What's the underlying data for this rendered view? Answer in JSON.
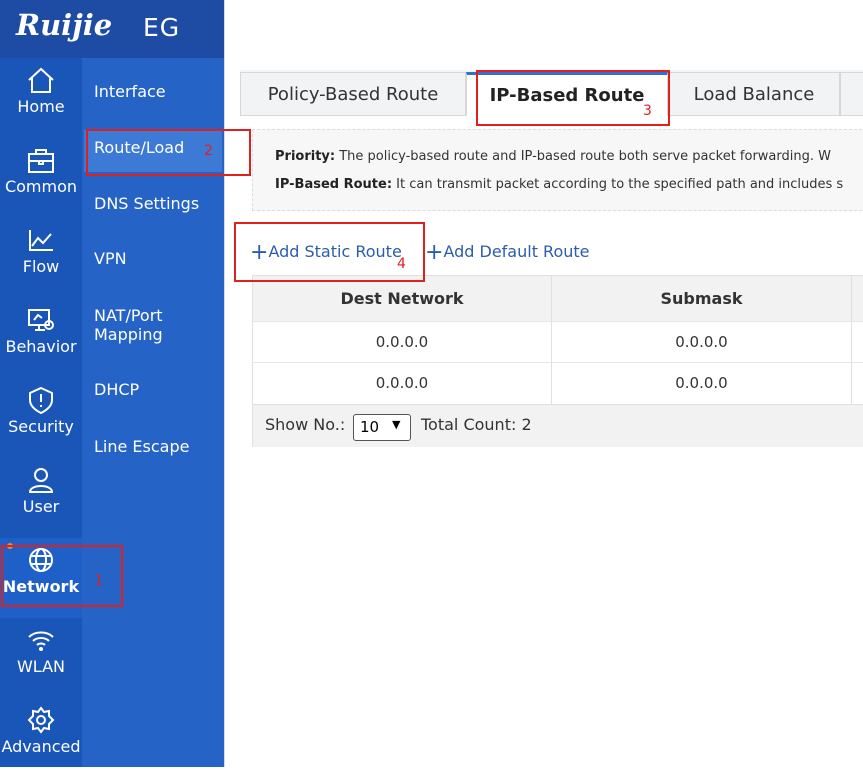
{
  "brand": {
    "logo": "Ruijie",
    "product": "EG"
  },
  "rail": [
    {
      "label": "Home",
      "icon": "home-icon"
    },
    {
      "label": "Common",
      "icon": "briefcase-icon"
    },
    {
      "label": "Flow",
      "icon": "chart-line-icon"
    },
    {
      "label": "Behavior",
      "icon": "monitor-icon"
    },
    {
      "label": "Security",
      "icon": "shield-icon"
    },
    {
      "label": "User",
      "icon": "user-icon"
    },
    {
      "label": "Network",
      "icon": "globe-icon"
    },
    {
      "label": "WLAN",
      "icon": "wifi-icon"
    },
    {
      "label": "Advanced",
      "icon": "gear-icon"
    }
  ],
  "subnav": [
    {
      "label": "Interface"
    },
    {
      "label": "Route/Load"
    },
    {
      "label": "DNS Settings"
    },
    {
      "label": "VPN"
    },
    {
      "label": "NAT/Port Mapping"
    },
    {
      "label": "DHCP"
    },
    {
      "label": "Line Escape"
    }
  ],
  "tabs": [
    {
      "label": "Policy-Based Route"
    },
    {
      "label": "IP-Based Route"
    },
    {
      "label": "Load Balance"
    }
  ],
  "info": {
    "priority_label": "Priority:",
    "priority_text": "The policy-based route and IP-based route both serve packet forwarding. W",
    "ipbased_label": "IP-Based Route:",
    "ipbased_text": "It can transmit packet according to the specified path and includes s"
  },
  "actions": {
    "add_static": "Add Static Route",
    "add_default": "Add Default Route"
  },
  "table": {
    "columns": [
      "Dest Network",
      "Submask"
    ],
    "rows": [
      [
        "0.0.0.0",
        "0.0.0.0"
      ],
      [
        "0.0.0.0",
        "0.0.0.0"
      ]
    ]
  },
  "pager": {
    "show_label": "Show No.:",
    "page_size": "10",
    "total": "Total Count: 2"
  },
  "annotations": {
    "n1": "1",
    "n2": "2",
    "n3": "3",
    "n4": "4"
  },
  "colors": {
    "rail": "#1a56b8",
    "subnav": "#2563c6",
    "accent": "#2f6fd6",
    "highlight": "#e0201c",
    "notify_dot": "#f08a24"
  }
}
